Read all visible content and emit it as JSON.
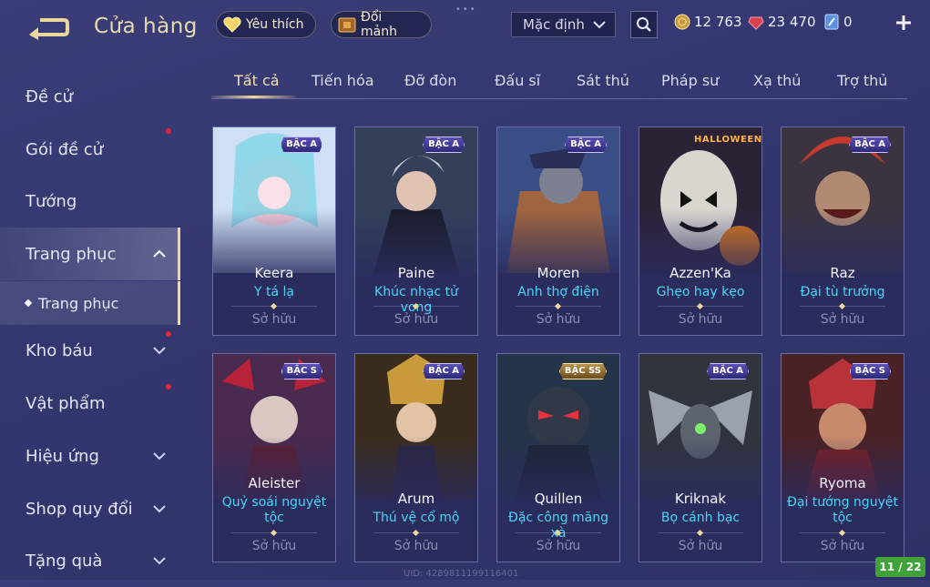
{
  "header": {
    "title": "Cửa hàng",
    "favorites_label": "Yêu thích",
    "shards_label": "Đổi mảnh",
    "sort_selected": "Mặc định",
    "currencies": [
      {
        "icon": "gold-coin-icon",
        "value": "12 763"
      },
      {
        "icon": "red-gem-icon",
        "value": "23 470"
      },
      {
        "icon": "voucher-icon",
        "value": "0"
      }
    ]
  },
  "sidebar": {
    "items": [
      {
        "label": "Đề cử"
      },
      {
        "label": "Gói đề cử",
        "badge": true
      },
      {
        "label": "Tướng"
      },
      {
        "label": "Trang phục",
        "expanded": true,
        "active": true
      },
      {
        "label": "Kho báu",
        "badge": true
      },
      {
        "label": "Vật phẩm",
        "badge": true
      },
      {
        "label": "Hiệu ứng"
      },
      {
        "label": "Shop quy đổi"
      },
      {
        "label": "Tặng quà"
      }
    ],
    "sub_item": "Trang phục"
  },
  "tabs": [
    "Tất cả",
    "Tiến hóa",
    "Đỡ đòn",
    "Đấu sĩ",
    "Sát thủ",
    "Pháp sư",
    "Xạ thủ",
    "Trợ thủ"
  ],
  "active_tab": 0,
  "cards": [
    {
      "hero": "Keera",
      "skin": "Y tá lạ",
      "tier": "BẬC A",
      "status": "Sở hữu"
    },
    {
      "hero": "Paine",
      "skin": "Khúc nhạc tử vong",
      "tier": "BẬC A",
      "status": "Sở hữu"
    },
    {
      "hero": "Moren",
      "skin": "Anh thợ điện",
      "tier": "BẬC A",
      "status": "Sở hữu"
    },
    {
      "hero": "Azzen'Ka",
      "skin": "Ghẹo hay kẹo",
      "tier": "",
      "tag": "HALLOWEEN",
      "status": "Sở hữu"
    },
    {
      "hero": "Raz",
      "skin": "Đại tù trưởng",
      "tier": "BẬC A",
      "status": "Sở hữu"
    },
    {
      "hero": "Aleister",
      "skin": "Quỷ soái nguyệt tộc",
      "tier": "BẬC S",
      "status": "Sở hữu"
    },
    {
      "hero": "Arum",
      "skin": "Thú vệ cổ mộ",
      "tier": "BẬC A",
      "status": "Sở hữu"
    },
    {
      "hero": "Quillen",
      "skin": "Đặc công mãng xà",
      "tier": "BẬC SS",
      "status": "Sở hữu"
    },
    {
      "hero": "Kriknak",
      "skin": "Bọ cánh bạc",
      "tier": "BẬC A",
      "status": "Sở hữu"
    },
    {
      "hero": "Ryoma",
      "skin": "Đại tướng nguyệt tộc",
      "tier": "BẬC S",
      "status": "Sở hữu"
    }
  ],
  "pager": "11 / 22",
  "uid": "UID: 4289811199116401",
  "colors": {
    "accent_gold": "#f2d79a",
    "skin_name": "#49d6f5",
    "badge_red": "#e5253c",
    "pager_green": "#3fa33a"
  }
}
